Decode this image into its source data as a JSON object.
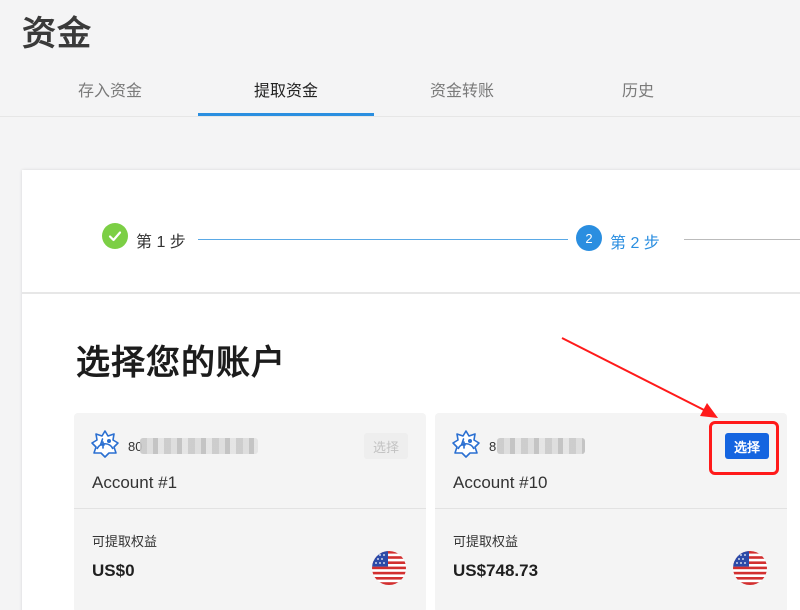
{
  "header": {
    "title": "资金"
  },
  "tabs": [
    {
      "label": "存入资金",
      "active": false
    },
    {
      "label": "提取资金",
      "active": true
    },
    {
      "label": "资金转账",
      "active": false
    },
    {
      "label": "历史",
      "active": false
    }
  ],
  "steps": {
    "step1_label": "第 1 步",
    "step1_status": "completed",
    "step2_number": "2",
    "step2_label": "第 2 步",
    "step2_status": "active"
  },
  "section": {
    "title": "选择您的账户"
  },
  "accounts": [
    {
      "account_prefix": "80",
      "name": "Account #1",
      "select_label": "选择",
      "select_enabled": false,
      "equity_label": "可提取权益",
      "equity_value": "US$0",
      "currency_flag": "us-flag-icon",
      "platform_icon": "metatrader-4-icon"
    },
    {
      "account_prefix": "8",
      "name": "Account #10",
      "select_label": "选择",
      "select_enabled": true,
      "equity_label": "可提取权益",
      "equity_value": "US$748.73",
      "currency_flag": "us-flag-icon",
      "platform_icon": "metatrader-4-icon"
    }
  ],
  "colors": {
    "accent": "#2a8ee0",
    "step_done": "#7ccf45",
    "primary_button": "#1565e0",
    "annotation": "#ff1a1a"
  }
}
